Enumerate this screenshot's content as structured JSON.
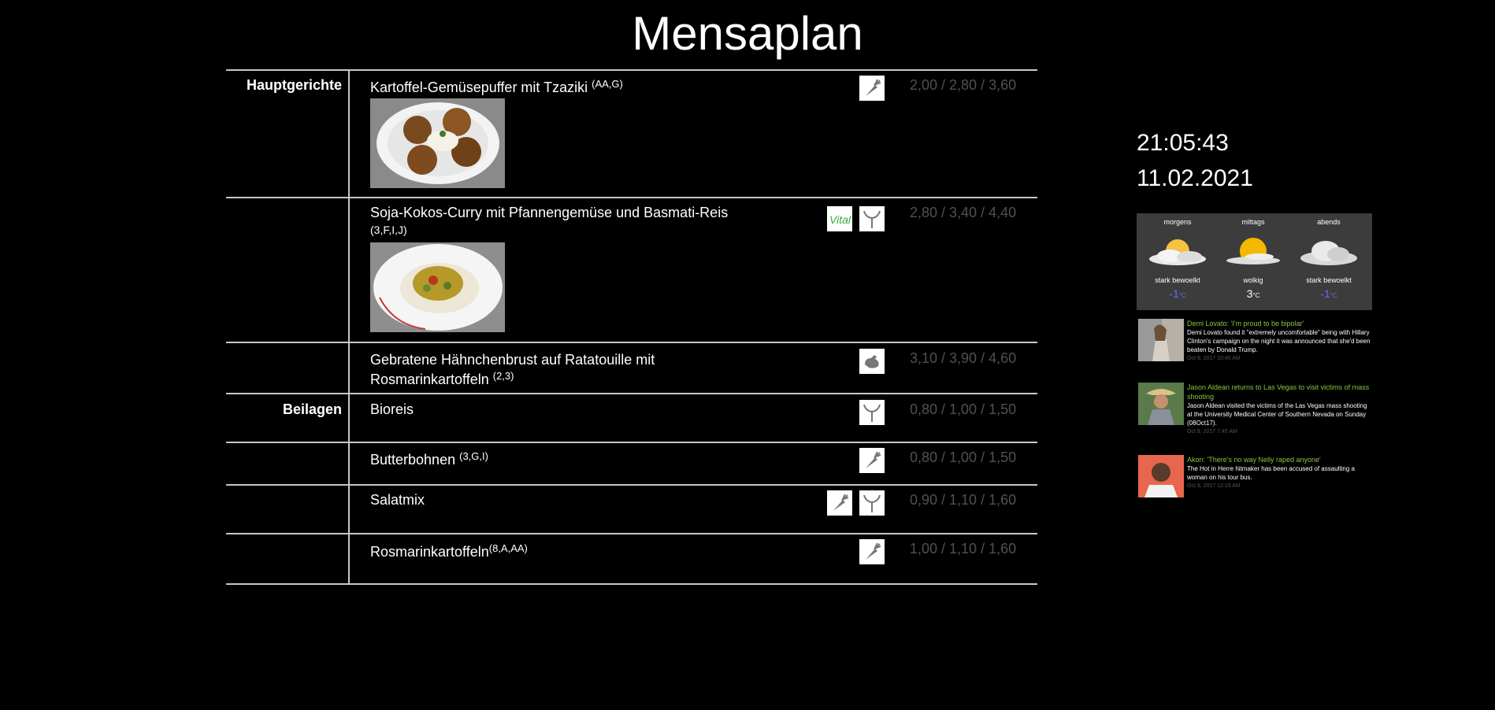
{
  "page": {
    "title": "Mensaplan"
  },
  "colors": {
    "background": "#000000",
    "rule": "#c8c8c8",
    "price": "#505050",
    "news_title": "#8cc63f",
    "temp_cold": "#6a6aff"
  },
  "menu": {
    "categories": [
      {
        "label": "Hauptgerichte"
      },
      {
        "label": "Beilagen"
      }
    ],
    "dishes": [
      {
        "name": "Kartoffel-Gemüsepuffer mit Tzaziki",
        "allergens": "(AA,G)",
        "prices": "2,00 / 2,80 / 3,60",
        "icons": [
          "vegetarian-carrot-icon"
        ],
        "photo": "potato-fritters-photo"
      },
      {
        "name": "Soja-Kokos-Curry mit Pfannengemüse und Basmati-Reis",
        "allergens": "(3,F,I,J)",
        "prices": "2,80 / 3,40 / 4,40",
        "icons": [
          "vital-icon",
          "vegan-sprout-icon"
        ],
        "photo": "curry-rice-photo",
        "vital_label": "Vital"
      },
      {
        "name_line1": "Gebratene Hähnchenbrust auf Ratatouille mit",
        "name_line2": "Rosmarinkartoffeln",
        "allergens": "(2,3)",
        "prices": "3,10 / 3,90 / 4,60",
        "icons": [
          "chicken-icon"
        ]
      },
      {
        "name": "Bioreis",
        "allergens": "",
        "prices": "0,80 / 1,00 / 1,50",
        "icons": [
          "vegan-sprout-icon"
        ]
      },
      {
        "name": "Butterbohnen",
        "allergens": "(3,G,I)",
        "prices": "0,80 / 1,00 / 1,50",
        "icons": [
          "vegetarian-carrot-icon"
        ]
      },
      {
        "name": "Salatmix",
        "allergens": "",
        "prices": "0,90 / 1,10 / 1,60",
        "icons": [
          "vegetarian-carrot-icon",
          "vegan-sprout-icon"
        ]
      },
      {
        "name": "Rosmarinkartoffeln",
        "allergens": "(8,A,AA)",
        "prices": "1,00 / 1,10 / 1,60",
        "icons": [
          "vegetarian-carrot-icon"
        ]
      }
    ]
  },
  "clock": {
    "time": "21:05:43",
    "date": "11.02.2021"
  },
  "weather": [
    {
      "label": "morgens",
      "desc": "stark bewoelkt",
      "temp": "-1",
      "unit": "°C",
      "icon": "sun-cloud-icon"
    },
    {
      "label": "mittags",
      "desc": "wolkig",
      "temp": "3",
      "unit": "°C",
      "icon": "sun-haze-icon"
    },
    {
      "label": "abends",
      "desc": "stark bewoelkt",
      "temp": "-1",
      "unit": "°C",
      "icon": "cloud-icon"
    }
  ],
  "news": [
    {
      "title": "Demi Lovato: 'I'm proud to be bipolar'",
      "text": "Demi Lovato found it \"extremely uncomfortable\" being with Hillary Clinton's campaign on the night it was announced that she'd been beaten by Donald Trump.",
      "time": "Oct 9, 2017 10:45 AM"
    },
    {
      "title": "Jason Aldean returns to Las Vegas to visit victims of mass shooting",
      "text": "Jason Aldean visited the victims of the Las Vegas mass shooting at the University Medical Center of Southern Nevada on Sunday (08Oct17).",
      "time": "Oct 9, 2017 7:45 AM"
    },
    {
      "title": "Akon: 'There's no way Nelly raped anyone'",
      "text": "The Hot in Herre hitmaker has been accused of assaulting a woman on his tour bus.",
      "time": "Oct 9, 2017 12:15 AM"
    }
  ]
}
